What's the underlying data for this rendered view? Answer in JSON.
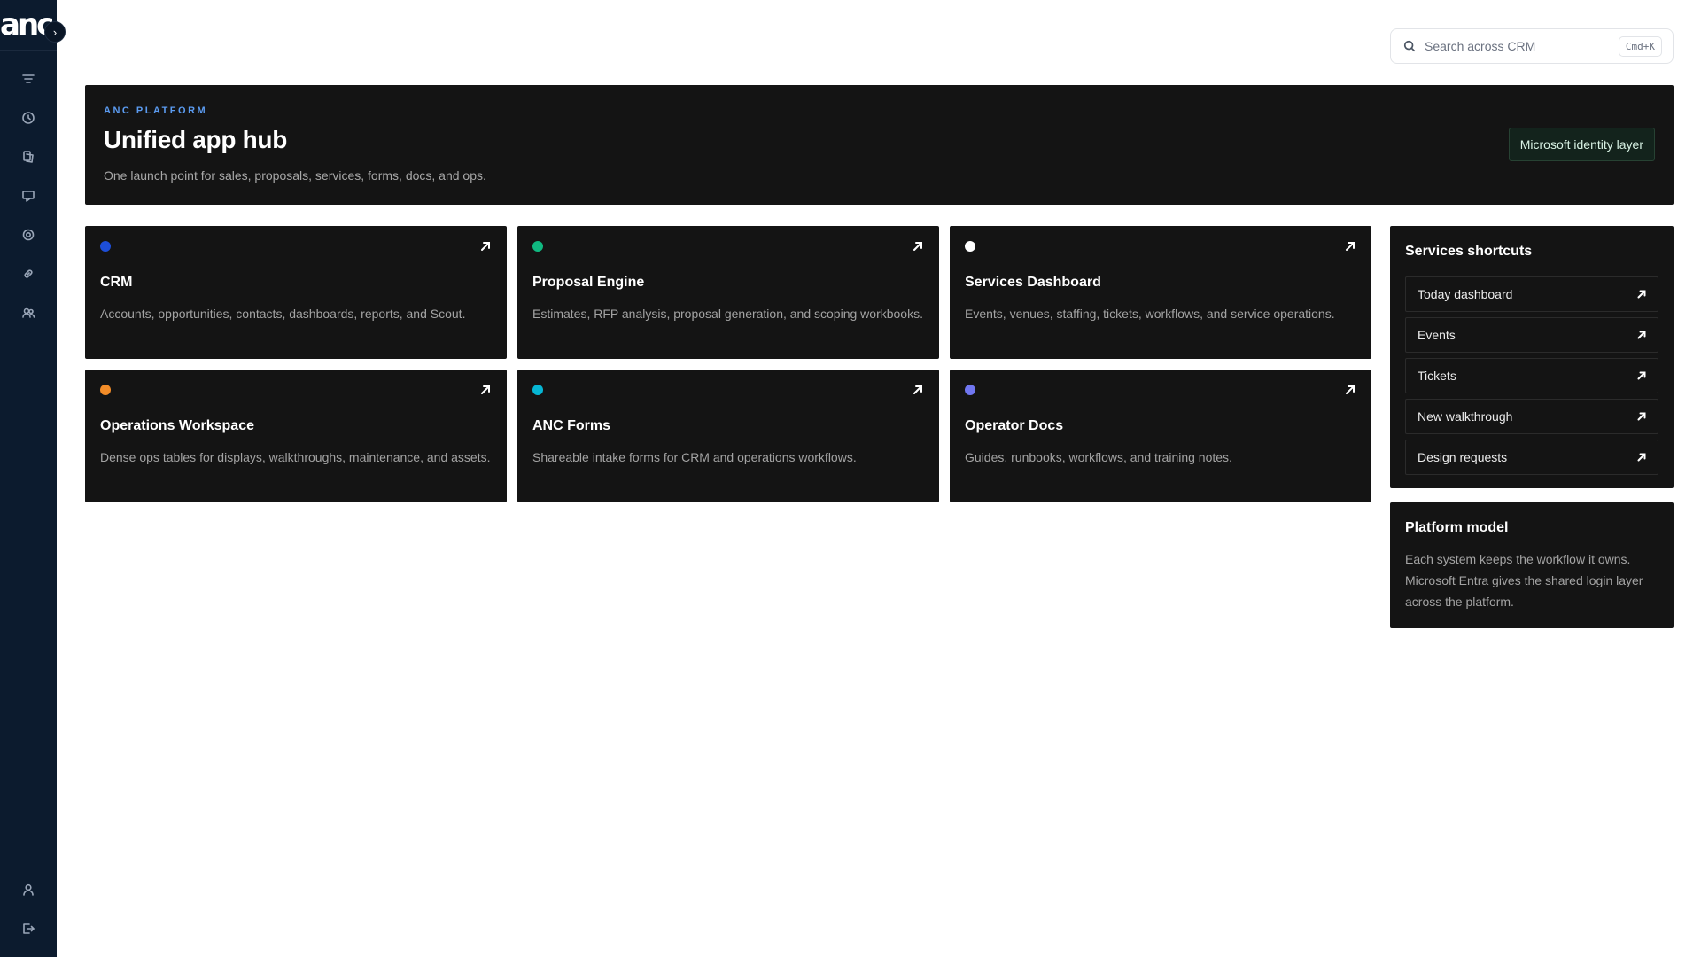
{
  "brand": {
    "logo_text": "anc"
  },
  "search": {
    "placeholder": "Search across CRM",
    "shortcut": "Cmd+K"
  },
  "hero": {
    "eyebrow": "ANC PLATFORM",
    "title": "Unified app hub",
    "subtitle": "One launch point for sales, proposals, services, forms, docs, and ops.",
    "badge": "Microsoft identity layer"
  },
  "apps": [
    {
      "title": "CRM",
      "description": "Accounts, opportunities, contacts, dashboards, reports, and Scout.",
      "color": "#1d4ed8"
    },
    {
      "title": "Proposal Engine",
      "description": "Estimates, RFP analysis, proposal generation, and scoping workbooks.",
      "color": "#10b981"
    },
    {
      "title": "Services Dashboard",
      "description": "Events, venues, staffing, tickets, workflows, and service operations.",
      "color": "#ffffff"
    },
    {
      "title": "Operations Workspace",
      "description": "Dense ops tables for displays, walkthroughs, maintenance, and assets.",
      "color": "#f28c28"
    },
    {
      "title": "ANC Forms",
      "description": "Shareable intake forms for CRM and operations workflows.",
      "color": "#06b6d4"
    },
    {
      "title": "Operator Docs",
      "description": "Guides, runbooks, workflows, and training notes.",
      "color": "#7076f0"
    }
  ],
  "shortcuts": {
    "title": "Services shortcuts",
    "items": [
      {
        "label": "Today dashboard"
      },
      {
        "label": "Events"
      },
      {
        "label": "Tickets"
      },
      {
        "label": "New walkthrough"
      },
      {
        "label": "Design requests"
      }
    ]
  },
  "platform": {
    "title": "Platform model",
    "text": "Each system keeps the workflow it owns. Microsoft Entra gives the shared login layer across the platform."
  },
  "icons": {
    "sidebar_top": [
      "filter-icon",
      "clock-icon",
      "documents-icon",
      "inbox-icon",
      "settings-icon",
      "link-icon",
      "users-icon"
    ],
    "sidebar_bottom": [
      "user-icon",
      "logout-icon"
    ]
  }
}
